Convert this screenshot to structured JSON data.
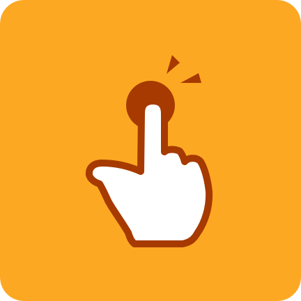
{
  "icon": {
    "name": "tap-gesture-icon",
    "colors": {
      "background": "#FDA823",
      "accent": "#A63A00",
      "hand_fill": "#FFFFFF"
    }
  }
}
